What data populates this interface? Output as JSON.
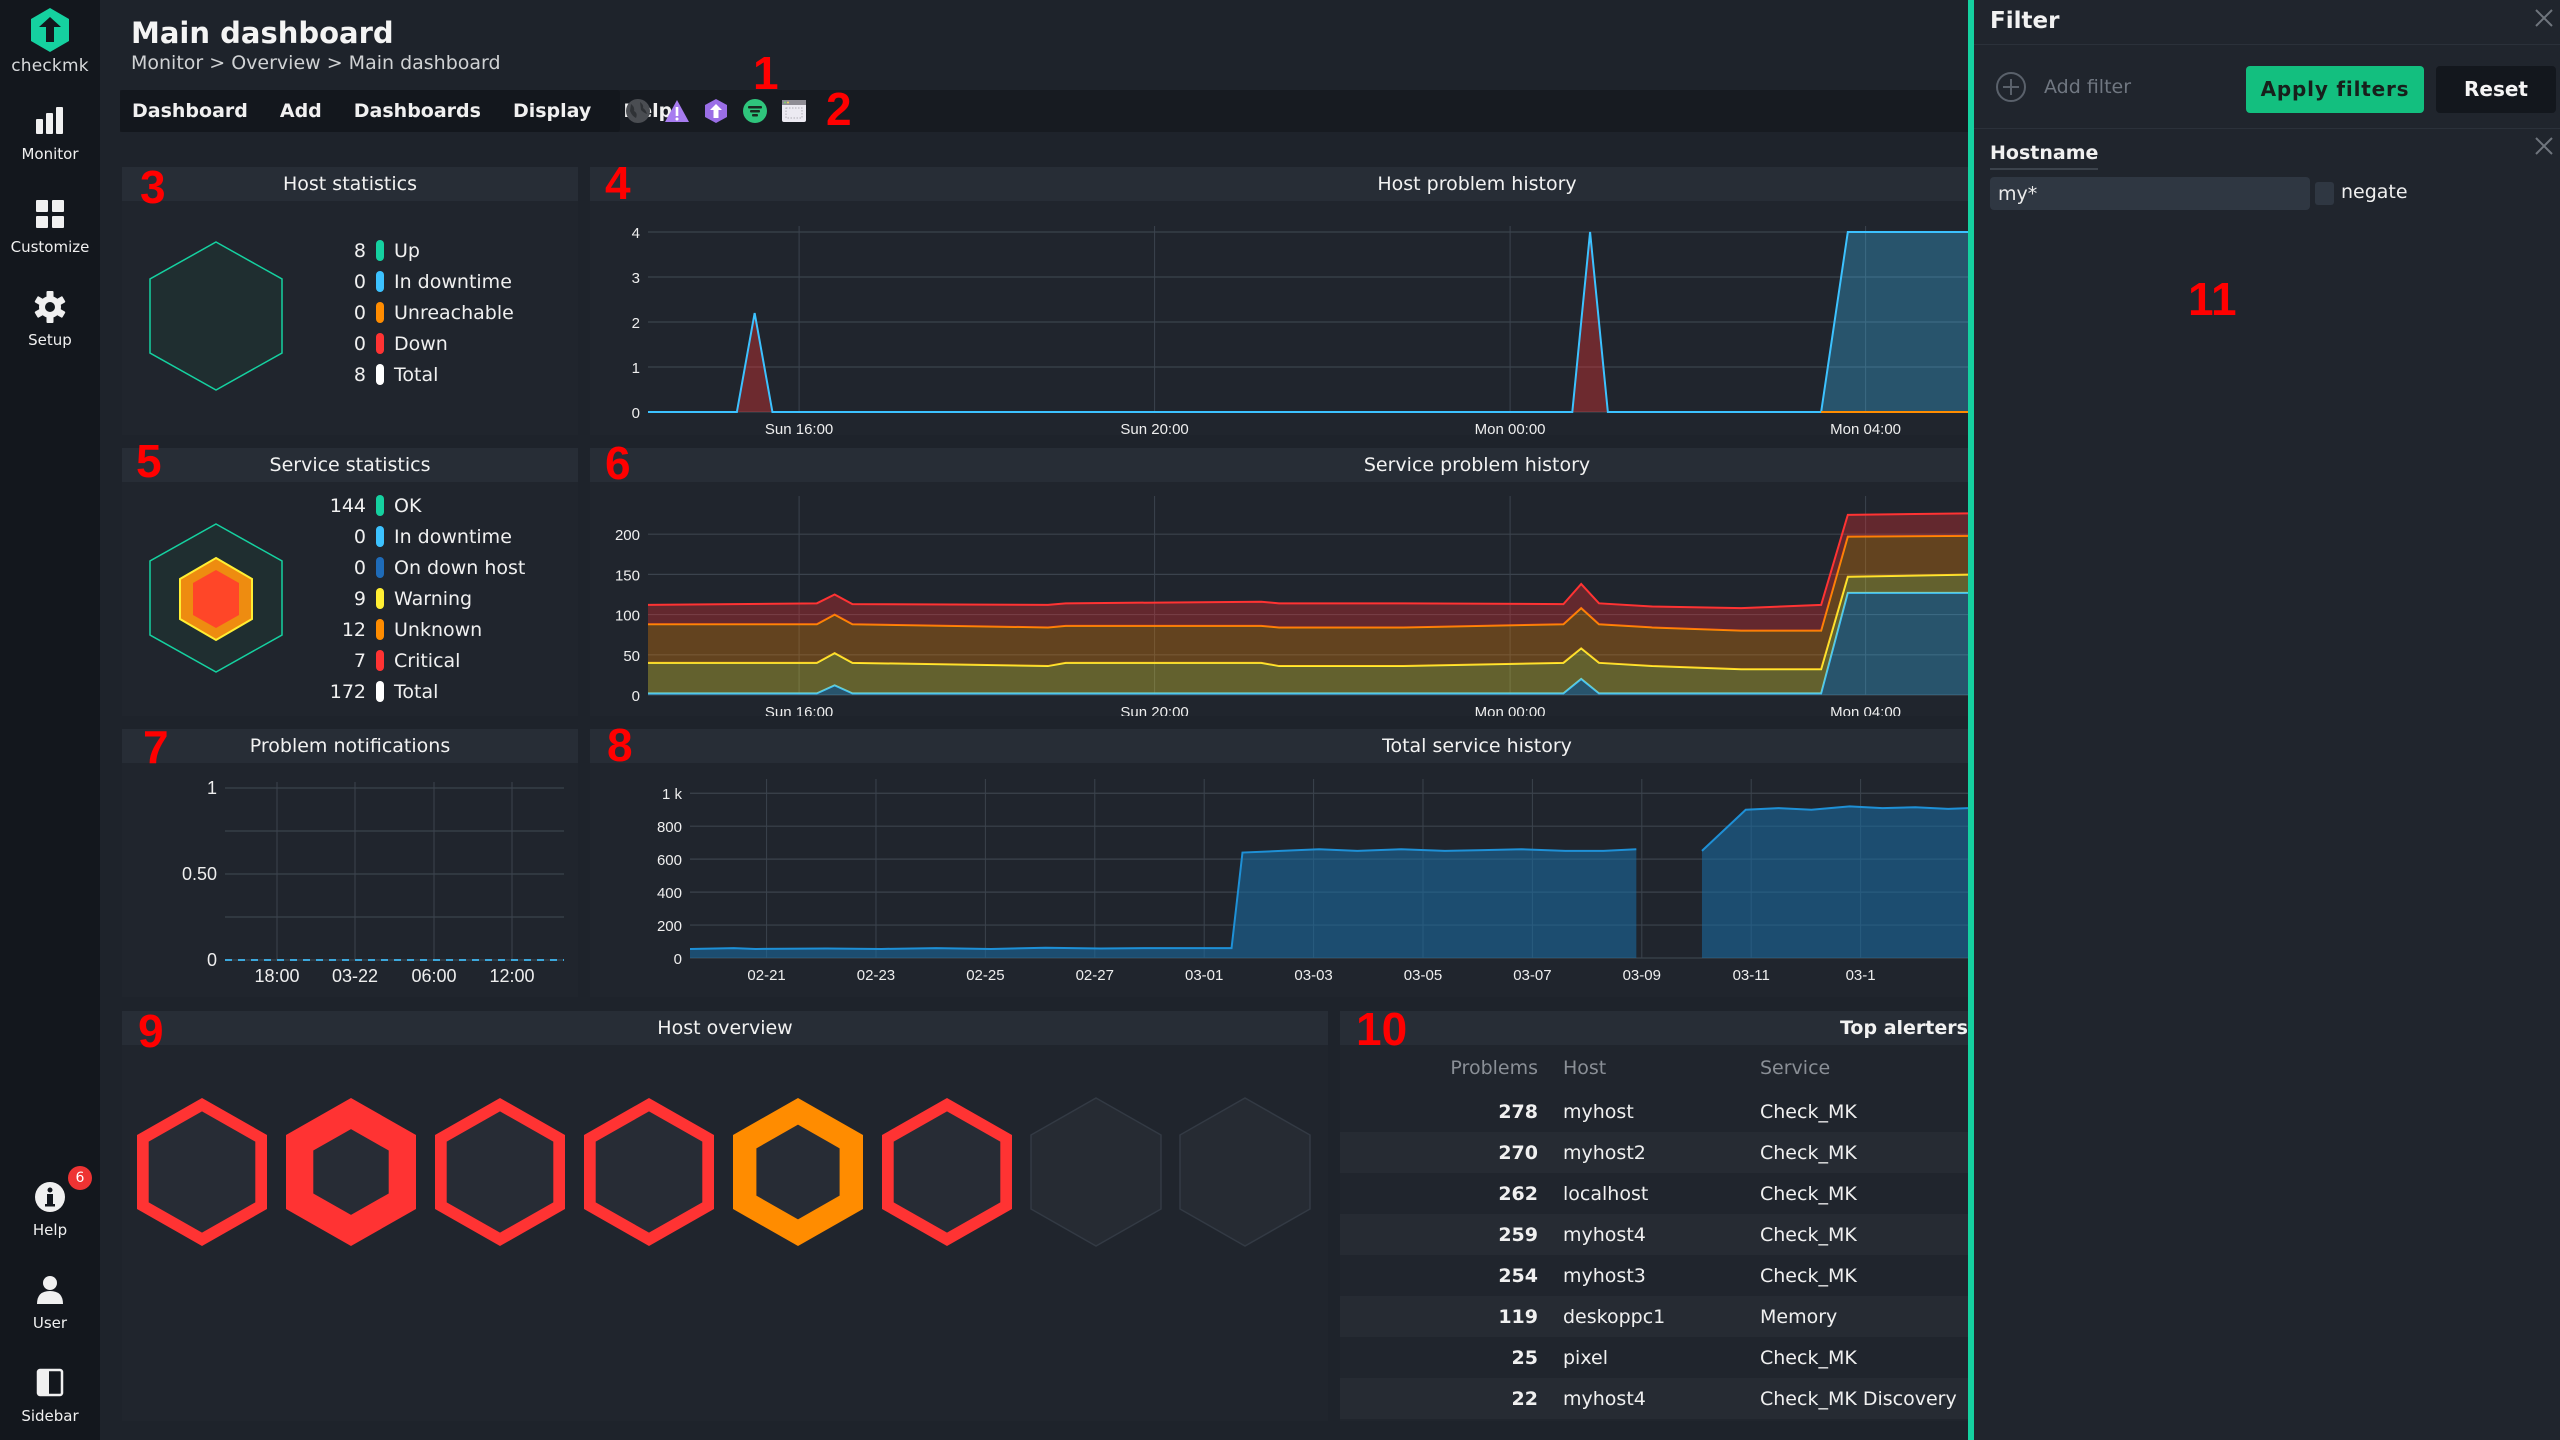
{
  "nav": {
    "brand": "checkmk",
    "items_top": [
      {
        "label": "Monitor",
        "icon": "bar-chart-icon"
      },
      {
        "label": "Customize",
        "icon": "grid-icon"
      },
      {
        "label": "Setup",
        "icon": "gear-icon"
      }
    ],
    "items_bottom": [
      {
        "label": "Help",
        "icon": "info-icon",
        "badge": "6"
      },
      {
        "label": "User",
        "icon": "user-icon"
      },
      {
        "label": "Sidebar",
        "icon": "sidebar-icon"
      }
    ]
  },
  "header": {
    "title": "Main dashboard",
    "breadcrumb": "Monitor > Overview > Main dashboard"
  },
  "menu": {
    "items": [
      "Dashboard",
      "Add",
      "Dashboards",
      "Display",
      "Help"
    ],
    "icons": [
      "globe-icon",
      "warning-icon",
      "checkmk-logo-icon",
      "filter-icon",
      "window-icon"
    ]
  },
  "annotations": [
    "1",
    "2",
    "3",
    "4",
    "5",
    "6",
    "7",
    "8",
    "9",
    "10",
    "11"
  ],
  "colors": {
    "ok": "#15d1a0",
    "downtime": "#3cc2ff",
    "on_down_host": "#1e6bb8",
    "warning": "#ffee33",
    "unknown": "#ff8c00",
    "critical": "#ff3333",
    "total": "#ffffff",
    "accent": "#15d1a0"
  },
  "host_stats": {
    "title": "Host statistics",
    "rows": [
      {
        "count": "8",
        "label": "Up",
        "color": "#15d1a0"
      },
      {
        "count": "0",
        "label": "In downtime",
        "color": "#3cc2ff"
      },
      {
        "count": "0",
        "label": "Unreachable",
        "color": "#ff8c00"
      },
      {
        "count": "0",
        "label": "Down",
        "color": "#ff3333"
      },
      {
        "count": "8",
        "label": "Total",
        "color": "#ffffff"
      }
    ]
  },
  "service_stats": {
    "title": "Service statistics",
    "rows": [
      {
        "count": "144",
        "label": "OK",
        "color": "#15d1a0"
      },
      {
        "count": "0",
        "label": "In downtime",
        "color": "#3cc2ff"
      },
      {
        "count": "0",
        "label": "On down host",
        "color": "#1e6bb8"
      },
      {
        "count": "9",
        "label": "Warning",
        "color": "#ffee33"
      },
      {
        "count": "12",
        "label": "Unknown",
        "color": "#ff8c00"
      },
      {
        "count": "7",
        "label": "Critical",
        "color": "#ff3333"
      },
      {
        "count": "172",
        "label": "Total",
        "color": "#ffffff"
      }
    ]
  },
  "host_overview": {
    "title": "Host overview",
    "hosts": [
      {
        "state": "critical",
        "color": "#ff3333",
        "weight": 0.15
      },
      {
        "state": "critical",
        "color": "#ff3333",
        "weight": 0.35
      },
      {
        "state": "critical",
        "color": "#ff3333",
        "weight": 0.15
      },
      {
        "state": "critical",
        "color": "#ff3333",
        "weight": 0.15
      },
      {
        "state": "unknown",
        "color": "#ff8c00",
        "weight": 0.3
      },
      {
        "state": "critical",
        "color": "#ff3333",
        "weight": 0.15
      },
      {
        "state": "ok",
        "color": "#2c323b",
        "weight": 0
      },
      {
        "state": "ok",
        "color": "#2c323b",
        "weight": 0
      }
    ]
  },
  "top_alerters": {
    "title": "Top alerters (la",
    "columns": [
      "Problems",
      "Host",
      "Service"
    ],
    "rows": [
      [
        "278",
        "myhost",
        "Check_MK"
      ],
      [
        "270",
        "myhost2",
        "Check_MK"
      ],
      [
        "262",
        "localhost",
        "Check_MK"
      ],
      [
        "259",
        "myhost4",
        "Check_MK"
      ],
      [
        "254",
        "myhost3",
        "Check_MK"
      ],
      [
        "119",
        "deskoppc1",
        "Memory"
      ],
      [
        "25",
        "pixel",
        "Check_MK"
      ],
      [
        "22",
        "myhost4",
        "Check_MK Discovery"
      ]
    ]
  },
  "filter": {
    "title": "Filter",
    "add_filter": "Add filter",
    "apply": "Apply filters",
    "reset": "Reset",
    "group_title": "Hostname",
    "hostname_value": "my*",
    "negate_label": "negate"
  },
  "chart_data": [
    {
      "id": "host_problem_history",
      "type": "area",
      "title": "Host problem history",
      "xlabel": "",
      "ylabel": "",
      "ylim": [
        0,
        4
      ],
      "yticks": [
        "0",
        "1",
        "2",
        "3",
        "4"
      ],
      "xticks": [
        "Sun 16:00",
        "Sun 20:00",
        "Mon 00:00",
        "Mon 04:00"
      ],
      "x_hours": [
        0,
        1.0,
        1.2,
        1.4,
        10.4,
        10.6,
        10.8,
        13.2,
        13.5,
        16
      ],
      "xtick_hours": [
        1.7,
        5.7,
        9.7,
        13.7
      ],
      "series": [
        {
          "name": "Down",
          "color": "#ff3333",
          "values": [
            0,
            0,
            2.2,
            0,
            0,
            4,
            0,
            0,
            0,
            0
          ]
        },
        {
          "name": "Unreachable",
          "color": "#ff8c00",
          "values": [
            0,
            0,
            0,
            0,
            0,
            0,
            0,
            0,
            0,
            0
          ]
        },
        {
          "name": "In downtime",
          "color": "#3cc2ff",
          "values": [
            0,
            0,
            0,
            0,
            0,
            0,
            0,
            0,
            4,
            4
          ]
        }
      ],
      "grid": true
    },
    {
      "id": "service_problem_history",
      "type": "area",
      "title": "Service problem history",
      "ylim": [
        0,
        240
      ],
      "yticks": [
        "0",
        "50",
        "100",
        "150",
        "200"
      ],
      "xticks": [
        "Sun 16:00",
        "Sun 20:00",
        "Mon 00:00",
        "Mon 04:00"
      ],
      "x_hours": [
        0,
        1.9,
        2.1,
        2.3,
        4.5,
        4.7,
        6.9,
        7.1,
        8.5,
        10.3,
        10.5,
        10.7,
        11.3,
        12.3,
        13.2,
        13.5,
        15.0,
        16
      ],
      "xtick_hours": [
        1.7,
        5.7,
        9.7,
        13.7
      ],
      "series": [
        {
          "name": "In downtime",
          "color": "#3cc2ff",
          "values": [
            2,
            2,
            12,
            2,
            2,
            2,
            2,
            2,
            2,
            2,
            20,
            2,
            2,
            2,
            2,
            127,
            127,
            127
          ]
        },
        {
          "name": "Warning",
          "color": "#ffee33",
          "values": [
            38,
            38,
            40,
            38,
            34,
            38,
            38,
            34,
            34,
            38,
            38,
            38,
            34,
            30,
            30,
            20,
            23,
            25
          ]
        },
        {
          "name": "Unknown",
          "color": "#ff8c00",
          "values": [
            48,
            48,
            48,
            48,
            48,
            46,
            46,
            48,
            48,
            48,
            50,
            48,
            48,
            48,
            48,
            50,
            48,
            49
          ]
        },
        {
          "name": "Critical",
          "color": "#ff3333",
          "values": [
            24,
            26,
            25,
            25,
            28,
            28,
            30,
            30,
            30,
            25,
            30,
            26,
            26,
            28,
            32,
            27,
            28,
            28
          ]
        }
      ],
      "grid": true
    },
    {
      "id": "problem_notifications",
      "type": "line",
      "title": "Problem notifications",
      "ylim": [
        0,
        1
      ],
      "yticks": [
        "0",
        "0.50",
        "1"
      ],
      "xticks": [
        "18:00",
        "03-22",
        "06:00",
        "12:00"
      ],
      "x": [
        0,
        1
      ],
      "values": [
        0,
        0
      ],
      "grid": true
    },
    {
      "id": "total_service_history",
      "type": "area",
      "title": "Total service history",
      "ylim": [
        0,
        1050
      ],
      "yticks": [
        "0",
        "200",
        "400",
        "600",
        "800",
        "1 k"
      ],
      "xticks": [
        "02-21",
        "02-23",
        "02-25",
        "02-27",
        "03-01",
        "03-03",
        "03-05",
        "03-07",
        "03-09",
        "03-11",
        "03-1"
      ],
      "x_days": [
        0,
        0.8,
        1.2,
        2.5,
        3.5,
        4.5,
        5.5,
        6.5,
        7.5,
        8.5,
        9.9,
        10.1,
        10.8,
        11.5,
        12.2,
        13.0,
        13.8,
        14.5,
        15.2,
        16.0,
        16.7,
        17.3,
        17.9,
        18.3,
        18.5,
        19.3,
        19.9,
        20.5,
        21.2,
        21.8,
        22.4,
        23.0,
        23.4
      ],
      "xtick_days": [
        1.4,
        3.4,
        5.4,
        7.4,
        9.4,
        11.4,
        13.4,
        15.4,
        17.4,
        19.4,
        21.4
      ],
      "values": [
        55,
        60,
        55,
        58,
        55,
        60,
        55,
        62,
        58,
        60,
        60,
        640,
        650,
        660,
        650,
        660,
        650,
        655,
        660,
        650,
        650,
        660,
        null,
        null,
        650,
        900,
        910,
        900,
        920,
        910,
        915,
        905,
        910
      ],
      "grid": true
    }
  ]
}
